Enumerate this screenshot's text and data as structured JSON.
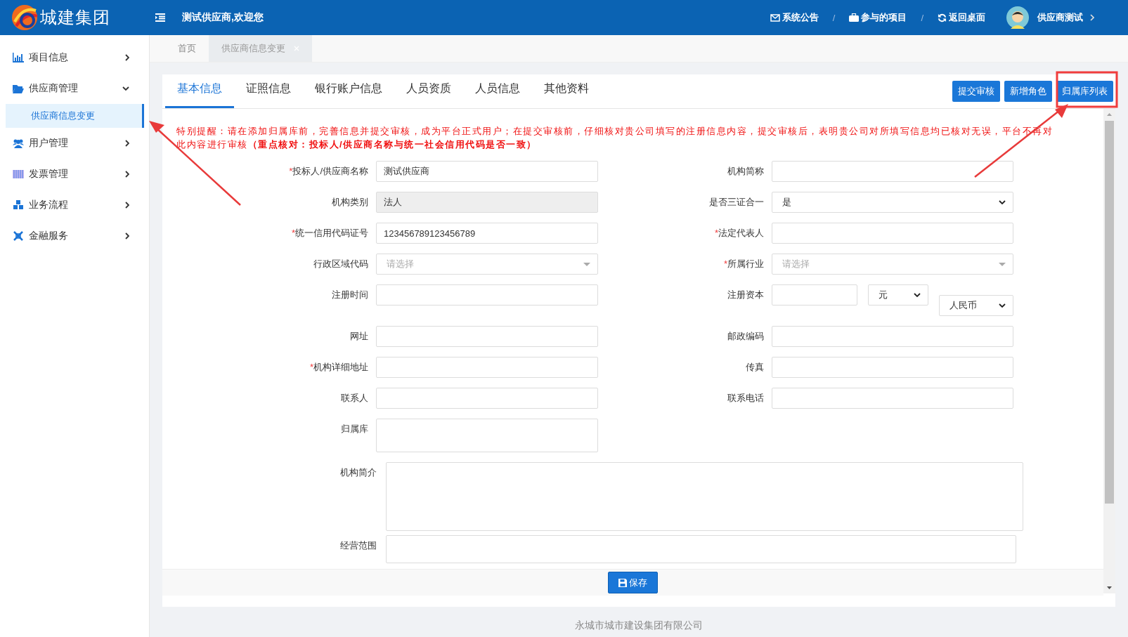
{
  "header": {
    "logo_text": "城建集团",
    "welcome": "测试供应商,欢迎您",
    "links": [
      {
        "kind": "mail",
        "label": "系统公告"
      },
      {
        "kind": "briefcase",
        "label": "参与的项目"
      },
      {
        "kind": "refresh",
        "label": "返回桌面"
      }
    ],
    "separator": "/",
    "user": "供应商测试"
  },
  "sidebar": {
    "items": [
      {
        "kind": "chart",
        "label": "项目信息",
        "expanded": false
      },
      {
        "kind": "folder",
        "label": "供应商管理",
        "expanded": true,
        "children": [
          {
            "label": "供应商信息变更",
            "selected": true
          }
        ]
      },
      {
        "kind": "users",
        "label": "用户管理",
        "expanded": false
      },
      {
        "kind": "barcode",
        "label": "发票管理",
        "expanded": false
      },
      {
        "kind": "cubes",
        "label": "业务流程",
        "expanded": false
      },
      {
        "kind": "cross",
        "label": "金融服务",
        "expanded": false
      }
    ]
  },
  "page_tabs": [
    {
      "label": "首页",
      "selected": false
    },
    {
      "label": "供应商信息变更",
      "selected": true
    }
  ],
  "form_tabs": [
    {
      "label": "基本信息",
      "selected": true
    },
    {
      "label": "证照信息",
      "selected": false
    },
    {
      "label": "银行账户信息",
      "selected": false
    },
    {
      "label": "人员资质",
      "selected": false
    },
    {
      "label": "人员信息",
      "selected": false
    },
    {
      "label": "其他资料",
      "selected": false
    }
  ],
  "actions": [
    "提交审核",
    "新增角色",
    "归属库列表"
  ],
  "notice": "特别提醒：请在添加归属库前，完善信息并提交审核，成为平台正式用户；在提交审核前，仔细核对贵公司填写的注册信息内容，提交审核后，表明贵公司对所填写信息均已核对无误，平台不再对此内容进行审核**（重点核对：投标人/供应商名称与统一社会信用代码是否一致）**",
  "form_rows": [
    [
      {
        "label": "投标人/供应商名称",
        "required_mark": "*",
        "kind": "text",
        "value": "测试供应商",
        "disabled": false
      },
      {
        "label": "机构简称",
        "kind": "text",
        "disabled": false
      }
    ],
    [
      {
        "label": "机构类别",
        "kind": "text",
        "value": "法人",
        "disabled": true
      },
      {
        "label": "是否三证合一",
        "kind": "select",
        "value": "是"
      }
    ],
    [
      {
        "label": "统一信用代码证号",
        "required_mark": "*",
        "kind": "text",
        "value": "123456789123456789",
        "disabled": false
      },
      {
        "label": "法定代表人",
        "required_mark": "*",
        "kind": "text",
        "disabled": false
      }
    ],
    [
      {
        "label": "行政区域代码",
        "kind": "dropdown",
        "placeholder": "请选择"
      },
      {
        "label": "所属行业",
        "required_mark": "*",
        "kind": "dropdown",
        "placeholder": "请选择"
      }
    ],
    [
      {
        "label": "注册时间",
        "kind": "text",
        "disabled": false
      },
      {
        "label": "注册资本",
        "kind": "capital",
        "unit": "元",
        "currency": "人民币"
      }
    ],
    [
      {
        "label": "网址",
        "kind": "text",
        "disabled": false
      },
      {
        "label": "邮政编码",
        "kind": "text",
        "disabled": false
      }
    ],
    [
      {
        "label": "机构详细地址",
        "required_mark": "*",
        "kind": "text",
        "disabled": false
      },
      {
        "label": "传真",
        "kind": "text",
        "disabled": false
      }
    ],
    [
      {
        "label": "联系人",
        "kind": "text",
        "disabled": false
      },
      {
        "label": "联系电话",
        "kind": "text",
        "disabled": false
      }
    ],
    [
      {
        "label": "归属库",
        "kind": "textarea"
      }
    ]
  ],
  "wide_fields": [
    {
      "label": "机构简介"
    },
    {
      "label": "经营范围"
    }
  ],
  "save_button": "保存",
  "footer": "永城市城市建设集团有限公司"
}
